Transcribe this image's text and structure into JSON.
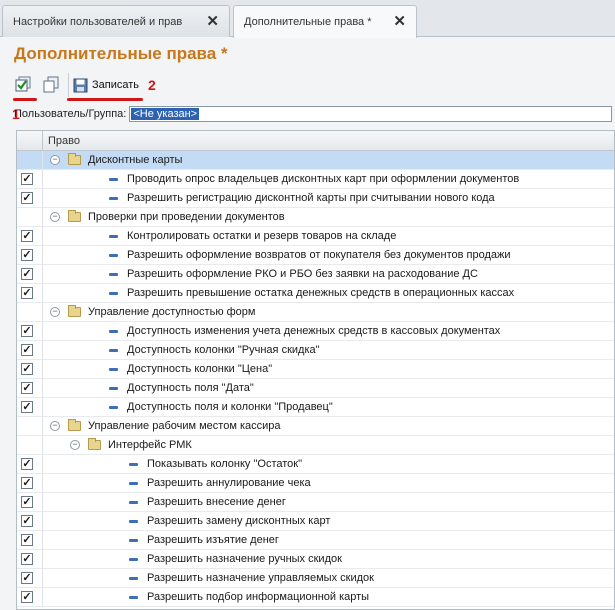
{
  "tabs": [
    {
      "label": "Настройки пользователей и прав",
      "close": "✕"
    },
    {
      "label": "Дополнительные права *",
      "close": "✕"
    }
  ],
  "title": "Дополнительные права *",
  "toolbar": {
    "save_label": "Записать",
    "marker_1": "1",
    "marker_2": "2"
  },
  "user_field": {
    "label": "Пользователь/Группа:",
    "value": "<Не указан>"
  },
  "table": {
    "header": "Право",
    "rows": [
      {
        "level": 0,
        "type": "group",
        "label": "Дисконтные карты",
        "selected": true
      },
      {
        "level": 1,
        "type": "item",
        "checked": true,
        "label": "Проводить опрос владельцев дисконтных карт при оформлении документов"
      },
      {
        "level": 1,
        "type": "item",
        "checked": true,
        "label": "Разрешить регистрацию дисконтной карты при считывании нового кода"
      },
      {
        "level": 0,
        "type": "group",
        "label": "Проверки при проведении документов"
      },
      {
        "level": 1,
        "type": "item",
        "checked": true,
        "label": "Контролировать остатки и резерв товаров на складе"
      },
      {
        "level": 1,
        "type": "item",
        "checked": true,
        "label": "Разрешить оформление возвратов от покупателя без документов продажи"
      },
      {
        "level": 1,
        "type": "item",
        "checked": true,
        "label": "Разрешить оформление РКО и РБО без заявки на расходование ДС"
      },
      {
        "level": 1,
        "type": "item",
        "checked": true,
        "label": "Разрешить превышение остатка денежных средств в операционных кассах"
      },
      {
        "level": 0,
        "type": "group",
        "label": "Управление доступностью форм"
      },
      {
        "level": 1,
        "type": "item",
        "checked": true,
        "label": "Доступность изменения учета денежных средств в кассовых документах"
      },
      {
        "level": 1,
        "type": "item",
        "checked": true,
        "label": "Доступность колонки \"Ручная скидка\""
      },
      {
        "level": 1,
        "type": "item",
        "checked": true,
        "label": "Доступность колонки \"Цена\""
      },
      {
        "level": 1,
        "type": "item",
        "checked": true,
        "label": "Доступность поля \"Дата\""
      },
      {
        "level": 1,
        "type": "item",
        "checked": true,
        "label": "Доступность поля и колонки \"Продавец\""
      },
      {
        "level": 0,
        "type": "group",
        "label": "Управление рабочим местом кассира"
      },
      {
        "level": 1,
        "type": "group",
        "label": "Интерфейс РМК"
      },
      {
        "level": 2,
        "type": "item",
        "checked": true,
        "label": "Показывать колонку \"Остаток\""
      },
      {
        "level": 2,
        "type": "item",
        "checked": true,
        "label": "Разрешить аннулирование чека"
      },
      {
        "level": 2,
        "type": "item",
        "checked": true,
        "label": "Разрешить внесение денег"
      },
      {
        "level": 2,
        "type": "item",
        "checked": true,
        "label": "Разрешить замену дисконтных карт"
      },
      {
        "level": 2,
        "type": "item",
        "checked": true,
        "label": "Разрешить изъятие денег"
      },
      {
        "level": 2,
        "type": "item",
        "checked": true,
        "label": "Разрешить назначение ручных скидок"
      },
      {
        "level": 2,
        "type": "item",
        "checked": true,
        "label": "Разрешить назначение управляемых скидок"
      },
      {
        "level": 2,
        "type": "item",
        "checked": true,
        "label": "Разрешить подбор информационной карты"
      }
    ]
  },
  "colors": {
    "title": "#c8771a",
    "annotation": "#d01616",
    "selection": "#c3dbf5"
  },
  "icons": [
    "check-all-icon",
    "copy-icon",
    "save-icon",
    "folder-icon",
    "collapse-icon",
    "item-dash-icon",
    "close-icon"
  ]
}
